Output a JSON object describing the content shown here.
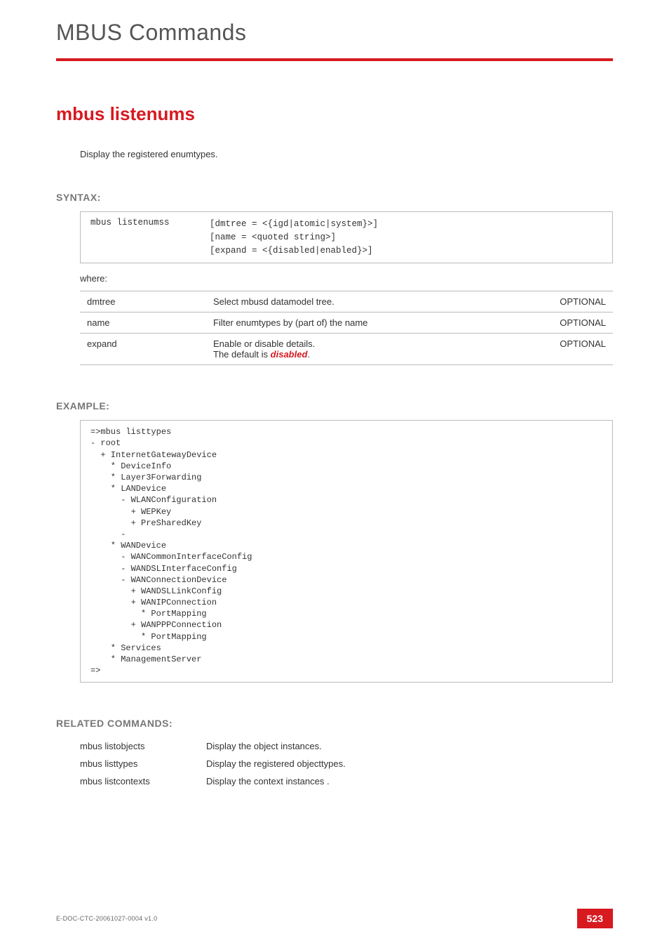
{
  "chapter": "MBUS Commands",
  "title": "mbus listenums",
  "intro": "Display the registered enumtypes.",
  "sections": {
    "syntax": "SYNTAX:",
    "example": "EXAMPLE:",
    "related": "RELATED COMMANDS:"
  },
  "syntax": {
    "command": "mbus listenumss",
    "args": "[dmtree = <{igd|atomic|system}>]\n[name = <quoted string>]\n[expand = <{disabled|enabled}>]"
  },
  "where_label": "where:",
  "params": [
    {
      "name": "dmtree",
      "desc": "Select mbusd datamodel tree.",
      "opt": "OPTIONAL"
    },
    {
      "name": "name",
      "desc": "Filter enumtypes by (part of) the name",
      "opt": "OPTIONAL"
    },
    {
      "name": "expand",
      "desc_prefix": "Enable or disable details.\nThe default is ",
      "desc_em": "disabled",
      "desc_suffix": ".",
      "opt": "OPTIONAL"
    }
  ],
  "example_output": "=>mbus listtypes\n- root\n  + InternetGatewayDevice\n    * DeviceInfo\n    * Layer3Forwarding\n    * LANDevice\n      - WLANConfiguration\n        + WEPKey\n        + PreSharedKey\n      -\n    * WANDevice\n      - WANCommonInterfaceConfig\n      - WANDSLInterfaceConfig\n      - WANConnectionDevice\n        + WANDSLLinkConfig\n        + WANIPConnection\n          * PortMapping\n        + WANPPPConnection\n          * PortMapping\n    * Services\n    * ManagementServer\n=>",
  "related": [
    {
      "name": "mbus listobjects",
      "desc": "Display the object instances."
    },
    {
      "name": "mbus listtypes",
      "desc": "Display the registered objecttypes."
    },
    {
      "name": "mbus listcontexts",
      "desc": "Display the context instances ."
    }
  ],
  "footer": {
    "doc_id": "E-DOC-CTC-20061027-0004 v1.0",
    "page": "523"
  }
}
